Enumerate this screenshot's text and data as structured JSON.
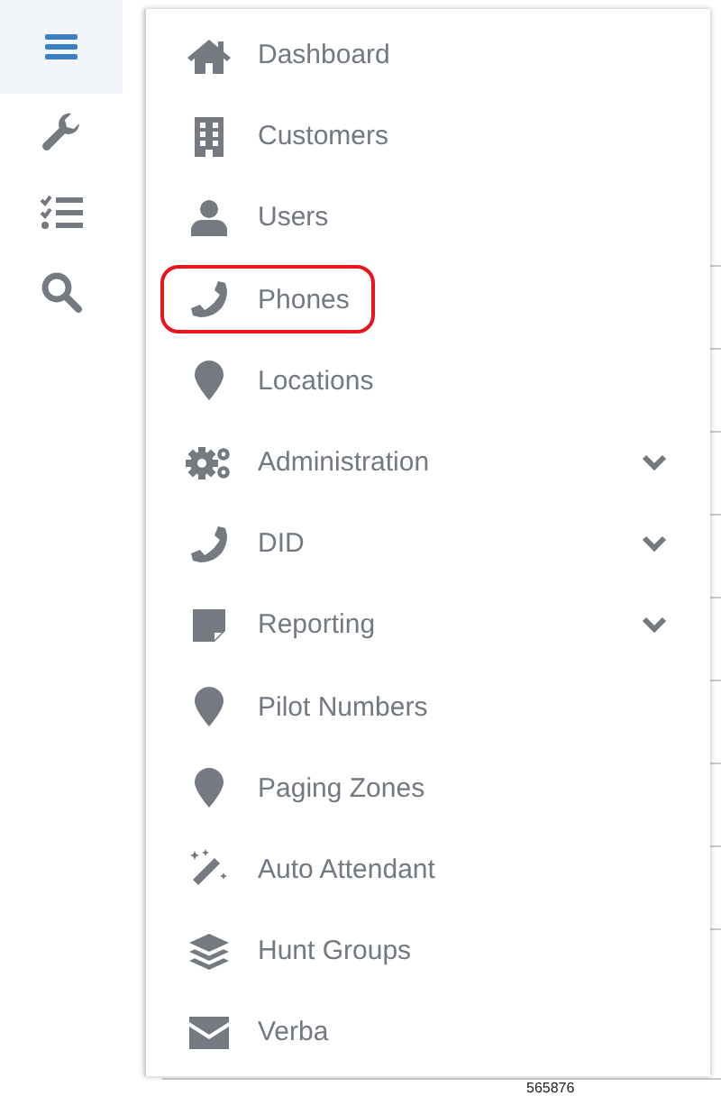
{
  "sidebar": {
    "items": [
      {
        "selected": true
      },
      {
        "selected": false
      },
      {
        "selected": false
      },
      {
        "selected": false
      }
    ]
  },
  "menu": {
    "items": [
      {
        "label": "Dashboard",
        "has_submenu": false,
        "circled": false
      },
      {
        "label": "Customers",
        "has_submenu": false,
        "circled": false
      },
      {
        "label": "Users",
        "has_submenu": false,
        "circled": false
      },
      {
        "label": "Phones",
        "has_submenu": false,
        "circled": true
      },
      {
        "label": "Locations",
        "has_submenu": false,
        "circled": false
      },
      {
        "label": "Administration",
        "has_submenu": true,
        "circled": false
      },
      {
        "label": "DID",
        "has_submenu": true,
        "circled": false
      },
      {
        "label": "Reporting",
        "has_submenu": true,
        "circled": false
      },
      {
        "label": "Pilot Numbers",
        "has_submenu": false,
        "circled": false
      },
      {
        "label": "Paging Zones",
        "has_submenu": false,
        "circled": false
      },
      {
        "label": "Auto Attendant",
        "has_submenu": false,
        "circled": false
      },
      {
        "label": "Hunt Groups",
        "has_submenu": false,
        "circled": false
      },
      {
        "label": "Verba",
        "has_submenu": false,
        "circled": false
      }
    ]
  },
  "background_row": {
    "cell": "565876"
  }
}
